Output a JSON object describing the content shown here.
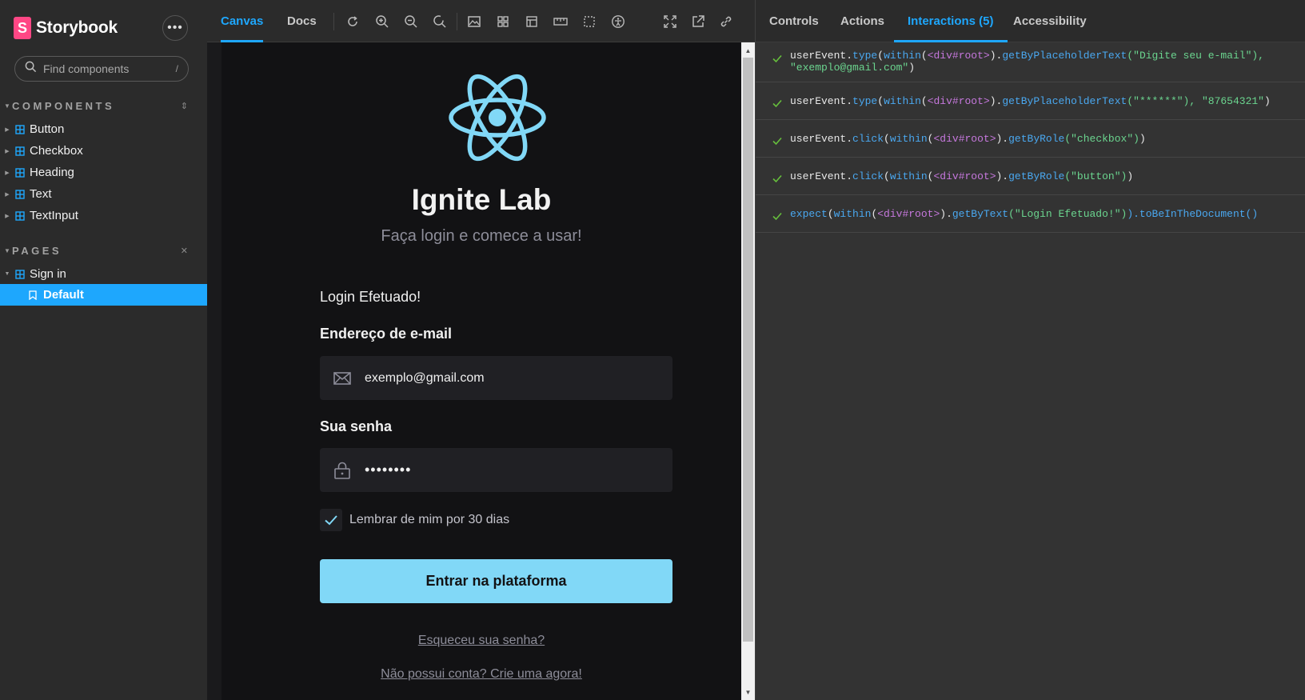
{
  "sidebar": {
    "brand": "Storybook",
    "brand_logo_letter": "S",
    "more_label": "•••",
    "search": {
      "placeholder": "Find components",
      "shortcut": "/"
    },
    "components_group": {
      "label": "COMPONENTS",
      "items": [
        {
          "label": "Button"
        },
        {
          "label": "Checkbox"
        },
        {
          "label": "Heading"
        },
        {
          "label": "Text"
        },
        {
          "label": "TextInput"
        }
      ]
    },
    "pages_group": {
      "label": "PAGES",
      "component": "Sign in",
      "story": "Default"
    }
  },
  "toolbar": {
    "tabs": [
      "Canvas",
      "Docs"
    ],
    "active_tab": "Canvas",
    "tools": [
      "reload-icon",
      "zoom-in-icon",
      "zoom-out-icon",
      "zoom-reset-icon",
      "background-icon",
      "grid-icon",
      "viewport-icon",
      "measure-icon",
      "outline-icon",
      "accessibility-icon",
      "fullscreen-icon",
      "open-new-tab-icon",
      "copy-link-icon"
    ]
  },
  "preview": {
    "title": "Ignite Lab",
    "subtitle": "Faça login e comece a usar!",
    "success_message": "Login Efetuado!",
    "email_label": "Endereço de e-mail",
    "email_value": "exemplo@gmail.com",
    "password_label": "Sua senha",
    "password_value": "••••••••",
    "remember_label": "Lembrar de mim por 30 dias",
    "remember_checked": true,
    "submit_label": "Entrar na plataforma",
    "forgot_link": "Esqueceu sua senha?",
    "signup_link": "Não possui conta? Crie uma agora!",
    "accent_color": "#81D8F7"
  },
  "addons": {
    "tabs": [
      "Controls",
      "Actions",
      "Interactions (5)",
      "Accessibility"
    ],
    "active_tab": "Interactions (5)",
    "steps": [
      {
        "status": "pass",
        "subject": "userEvent",
        "method": "type",
        "within": "within",
        "element": "<div#root>",
        "query": "getByPlaceholderText",
        "args_open": "(\"Digite seu e-mail\"), ",
        "extra": "\"exemplo@gmail.com\"",
        "close": ")"
      },
      {
        "status": "pass",
        "subject": "userEvent",
        "method": "type",
        "within": "within",
        "element": "<div#root>",
        "query": "getByPlaceholderText",
        "args_open": "(\"******\"), ",
        "extra": "\"87654321\"",
        "close": ")"
      },
      {
        "status": "pass",
        "subject": "userEvent",
        "method": "click",
        "within": "within",
        "element": "<div#root>",
        "query": "getByRole",
        "args_open": "(\"checkbox\")",
        "extra": "",
        "close": ")"
      },
      {
        "status": "pass",
        "subject": "userEvent",
        "method": "click",
        "within": "within",
        "element": "<div#root>",
        "query": "getByRole",
        "args_open": "(\"button\")",
        "extra": "",
        "close": ")"
      },
      {
        "status": "pass",
        "subject": "expect",
        "method": "",
        "within": "within",
        "element": "<div#root>",
        "query": "getByText",
        "args_open": "(\"Login Efetuado!\")",
        "extra": "",
        "close": ").toBeInTheDocument()"
      }
    ]
  }
}
